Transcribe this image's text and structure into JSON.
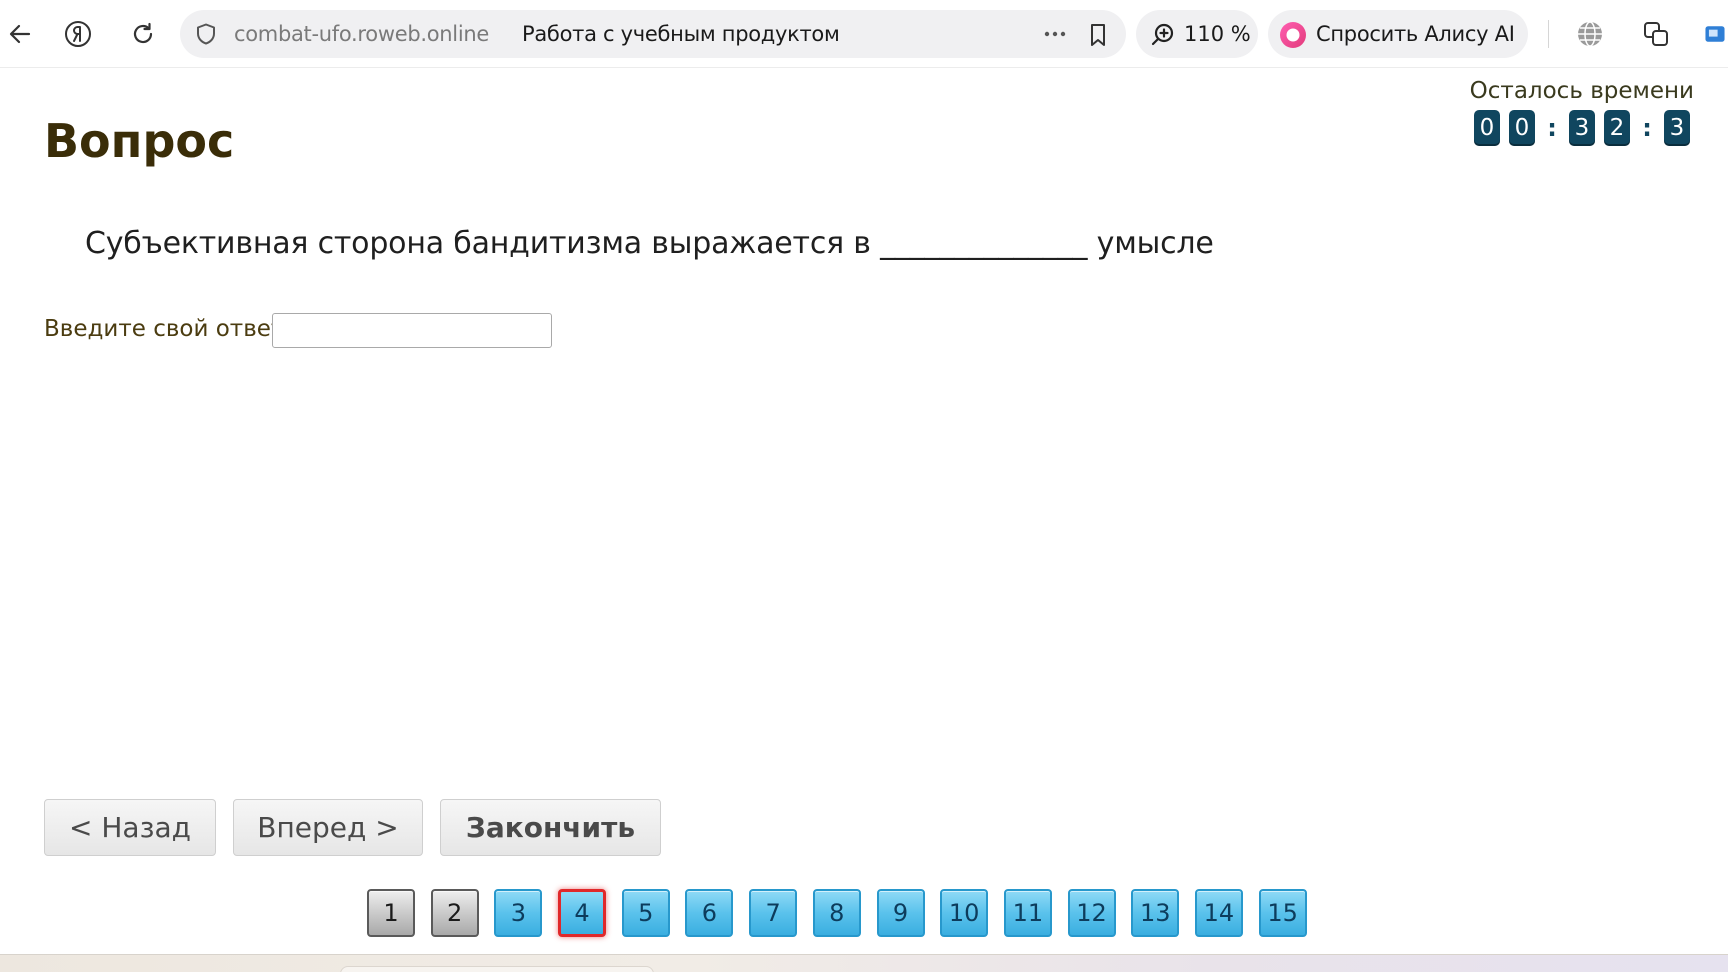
{
  "browser": {
    "url_domain": "combat-ufo.roweb.online",
    "page_title": "Работа с учебным продуктом",
    "zoom": "110 %",
    "alisa_label": "Спросить Алису AI",
    "icons": {
      "back": "arrow-left-icon",
      "yandex": "yandex-logo-icon",
      "reload": "reload-icon",
      "shield": "shield-icon",
      "more": "more-dots-icon",
      "bookmark": "bookmark-icon",
      "zoom": "zoom-icon",
      "alisa": "alisa-logo-icon",
      "translate": "globe-icon",
      "extensions": "extension-icon"
    }
  },
  "timer": {
    "label": "Осталось времени",
    "digits": [
      "0",
      "0",
      "3",
      "2",
      "3"
    ]
  },
  "question": {
    "heading": "Вопрос",
    "text": "Субъективная сторона бандитизма выражается в ______________ умысле",
    "answer_label": "Введите свой ответ",
    "answer_value": ""
  },
  "nav": {
    "back": "< Назад",
    "forward": "Вперед >",
    "finish": "Закончить"
  },
  "pager": {
    "current": 4,
    "pages": [
      {
        "label": "1",
        "state": "done"
      },
      {
        "label": "2",
        "state": "done"
      },
      {
        "label": "3",
        "state": "open"
      },
      {
        "label": "4",
        "state": "current"
      },
      {
        "label": "5",
        "state": "open"
      },
      {
        "label": "6",
        "state": "open"
      },
      {
        "label": "7",
        "state": "open"
      },
      {
        "label": "8",
        "state": "open"
      },
      {
        "label": "9",
        "state": "open"
      },
      {
        "label": "10",
        "state": "open"
      },
      {
        "label": "11",
        "state": "open"
      },
      {
        "label": "12",
        "state": "open"
      },
      {
        "label": "13",
        "state": "open"
      },
      {
        "label": "14",
        "state": "open"
      },
      {
        "label": "15",
        "state": "open"
      }
    ]
  },
  "colors": {
    "heading": "#3a2d08",
    "timer_digit_bg": "#10465f",
    "page_open": "#5ac2ec",
    "page_done": "#c7c7c7",
    "page_current_border": "#e0282a"
  }
}
